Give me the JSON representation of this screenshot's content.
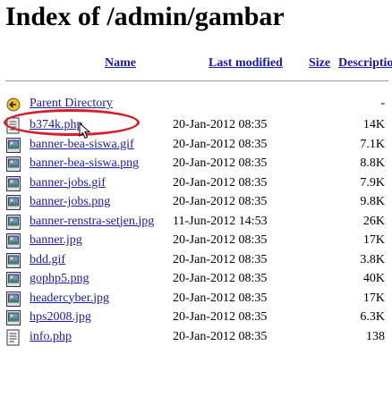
{
  "page": {
    "heading": "Index of /admin/gambar"
  },
  "columns": {
    "name": "Name",
    "last_modified": "Last modified",
    "size": "Size",
    "description": "Description"
  },
  "parent": {
    "label": "Parent Directory",
    "size": "-",
    "icon": "back-arrow-icon"
  },
  "files": [
    {
      "name": "b374k.php",
      "modified": "20-Jan-2012 08:35",
      "size": "14K",
      "icon": "text-file-icon"
    },
    {
      "name": "banner-bea-siswa.gif",
      "modified": "20-Jan-2012 08:35",
      "size": "7.1K",
      "icon": "image-file-icon"
    },
    {
      "name": "banner-bea-siswa.png",
      "modified": "20-Jan-2012 08:35",
      "size": "8.8K",
      "icon": "image-file-icon"
    },
    {
      "name": "banner-jobs.gif",
      "modified": "20-Jan-2012 08:35",
      "size": "7.9K",
      "icon": "image-file-icon"
    },
    {
      "name": "banner-jobs.png",
      "modified": "20-Jan-2012 08:35",
      "size": "9.8K",
      "icon": "image-file-icon"
    },
    {
      "name": "banner-renstra-setjen.jpg",
      "modified": "11-Jun-2012 14:53",
      "size": "26K",
      "icon": "image-file-icon"
    },
    {
      "name": "banner.jpg",
      "modified": "20-Jan-2012 08:35",
      "size": "17K",
      "icon": "image-file-icon"
    },
    {
      "name": "bdd.gif",
      "modified": "20-Jan-2012 08:35",
      "size": "3.8K",
      "icon": "image-file-icon"
    },
    {
      "name": "gophp5.png",
      "modified": "20-Jan-2012 08:35",
      "size": "40K",
      "icon": "image-file-icon"
    },
    {
      "name": "headercyber.jpg",
      "modified": "20-Jan-2012 08:35",
      "size": "17K",
      "icon": "image-file-icon"
    },
    {
      "name": "hps2008.jpg",
      "modified": "20-Jan-2012 08:35",
      "size": "6.3K",
      "icon": "image-file-icon"
    },
    {
      "name": "info.php",
      "modified": "20-Jan-2012 08:35",
      "size": "138",
      "icon": "text-file-icon"
    }
  ],
  "colors": {
    "link": "#1a1aa8",
    "highlight_circle": "#d4202a"
  }
}
